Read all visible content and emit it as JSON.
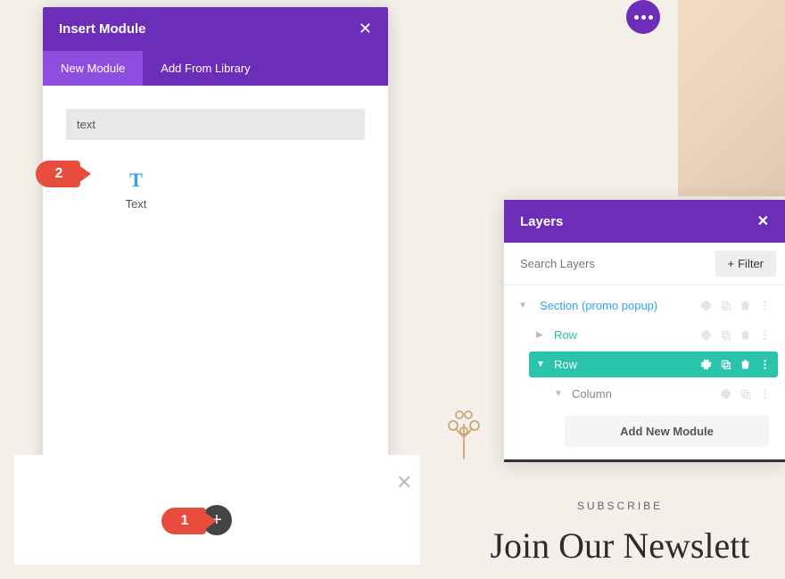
{
  "insert_module": {
    "title": "Insert Module",
    "tabs": {
      "new": "New Module",
      "library": "Add From Library"
    },
    "search_value": "text",
    "results": [
      {
        "label": "Text",
        "icon": "T"
      }
    ]
  },
  "layers": {
    "title": "Layers",
    "search_placeholder": "Search Layers",
    "filter_label": "Filter",
    "tree": {
      "section": "Section (promo popup)",
      "row1": "Row",
      "row2": "Row",
      "column": "Column",
      "add_module": "Add New Module"
    }
  },
  "newsletter": {
    "subtitle": "SUBSCRIBE",
    "title": "Join Our Newslett"
  },
  "callouts": {
    "one": "1",
    "two": "2"
  }
}
